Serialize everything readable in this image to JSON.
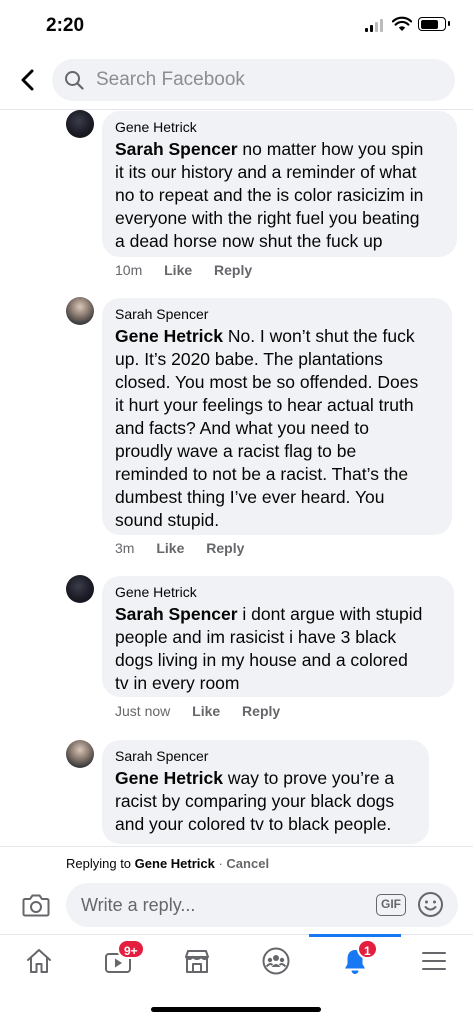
{
  "status_bar": {
    "time": "2:20",
    "battery_level": 0.75
  },
  "header": {
    "search_placeholder": "Search Facebook"
  },
  "comments": [
    {
      "author": "Gene Hetrick",
      "mention": "Sarah Spencer",
      "text_lines": [
        " no matter how you spin",
        "it its our history and a reminder of what",
        "no to repeat and the is color rasicizim in",
        "everyone with the right fuel you beating",
        "a dead horse  now shut the fuck up"
      ],
      "time": "10m",
      "like": "Like",
      "reply": "Reply"
    },
    {
      "author": "Sarah Spencer",
      "mention": "Gene Hetrick",
      "text_lines": [
        " No. I won’t shut the fuck",
        "up. It’s 2020 babe. The plantations",
        "closed. You most be so offended. Does",
        "it hurt your feelings to hear actual truth",
        "and facts? And what you need to",
        "proudly wave a racist flag to be",
        "reminded to not be a racist. That’s the",
        "dumbest thing I’ve ever heard. You",
        "sound stupid."
      ],
      "time": "3m",
      "like": "Like",
      "reply": "Reply"
    },
    {
      "author": "Gene Hetrick",
      "mention": "Sarah Spencer",
      "text_lines": [
        " i dont argue with stupid",
        "people and im rasicist i have 3 black",
        "dogs living in my house and a colored",
        "tv in every room"
      ],
      "time": "Just now",
      "like": "Like",
      "reply": "Reply"
    },
    {
      "author": "Sarah Spencer",
      "mention": "Gene Hetrick",
      "text_lines": [
        " way to prove you’re a",
        "racist by comparing your black dogs",
        "and your colored tv to black people."
      ]
    }
  ],
  "replying": {
    "prefix": "Replying to ",
    "name": "Gene Hetrick",
    "separator": " · ",
    "cancel": "Cancel"
  },
  "composer": {
    "placeholder": "Write a reply...",
    "gif_label": "GIF"
  },
  "tabbar": {
    "tabs": [
      "home-icon",
      "watch-icon",
      "marketplace-icon",
      "groups-icon",
      "notifications-icon",
      "menu-icon"
    ],
    "watch_badge": "9+",
    "notifications_badge": "1",
    "active_color": "#1877f2",
    "badge_color": "#e41e3f"
  }
}
